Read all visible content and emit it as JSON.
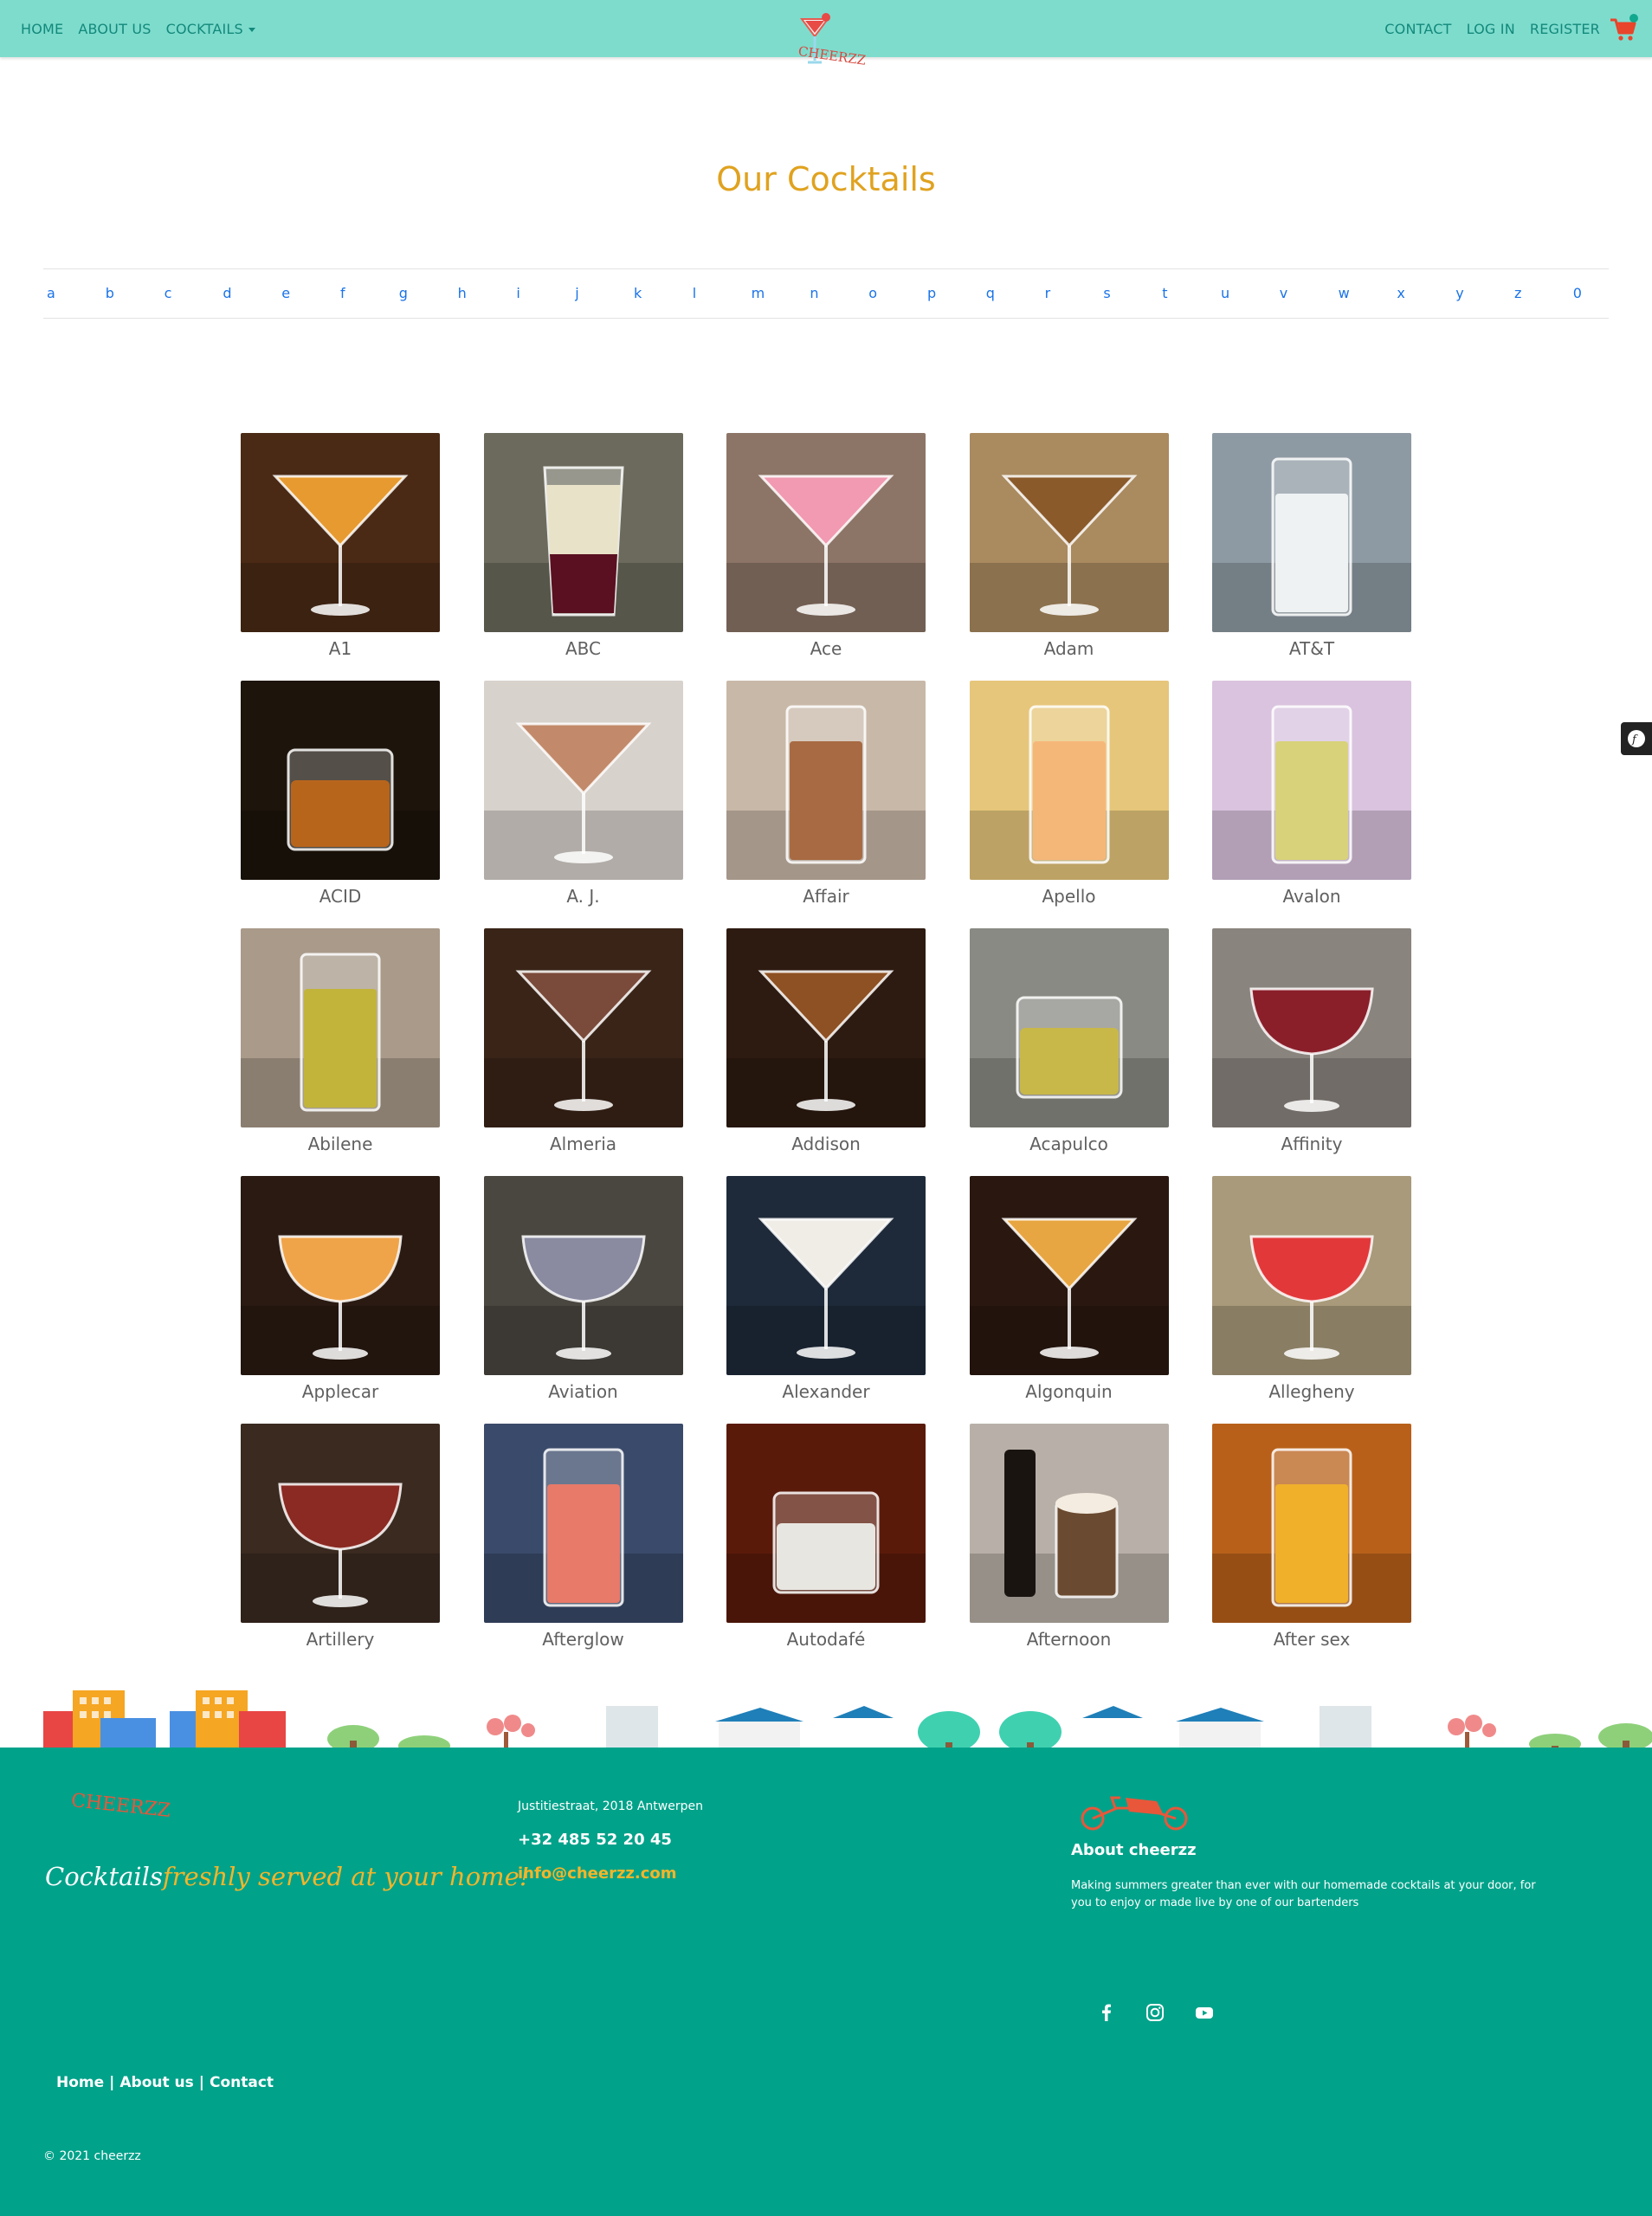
{
  "nav": {
    "home": "HOME",
    "about": "ABOUT US",
    "cocktails": "COCKTAILS",
    "contact": "CONTACT",
    "login": "LOG IN",
    "register": "REGISTER",
    "logo_text": "CHEERZZ"
  },
  "page_title": "Our Cocktails",
  "alphabet": [
    "a",
    "b",
    "c",
    "d",
    "e",
    "f",
    "g",
    "h",
    "i",
    "j",
    "k",
    "l",
    "m",
    "n",
    "o",
    "p",
    "q",
    "r",
    "s",
    "t",
    "u",
    "v",
    "w",
    "x",
    "y",
    "z",
    "0"
  ],
  "cocktails": [
    {
      "name": "A1",
      "bg": "#4a2a15",
      "accent": "#e79a2f",
      "glass": "martini"
    },
    {
      "name": "ABC",
      "bg": "#6b6a5c",
      "accent": "#e8e2c8",
      "glass": "shot"
    },
    {
      "name": "Ace",
      "bg": "#8c7466",
      "accent": "#f19ab1",
      "glass": "martini"
    },
    {
      "name": "Adam",
      "bg": "#aa8a5f",
      "accent": "#8a5a2a",
      "glass": "martini"
    },
    {
      "name": "AT&T",
      "bg": "#8e9aa3",
      "accent": "#eef2f2",
      "glass": "highball"
    },
    {
      "name": "ACID",
      "bg": "#1d140c",
      "accent": "#b8651c",
      "glass": "rocks"
    },
    {
      "name": "A. J.",
      "bg": "#d8d2cc",
      "accent": "#c28a6a",
      "glass": "martini"
    },
    {
      "name": "Affair",
      "bg": "#c8b8a8",
      "accent": "#a86a42",
      "glass": "highball"
    },
    {
      "name": "Apello",
      "bg": "#e6c67a",
      "accent": "#f5b778",
      "glass": "highball"
    },
    {
      "name": "Avalon",
      "bg": "#d9c3df",
      "accent": "#d8d27a",
      "glass": "highball"
    },
    {
      "name": "Abilene",
      "bg": "#a99a8a",
      "accent": "#c2b43a",
      "glass": "highball"
    },
    {
      "name": "Almeria",
      "bg": "#3a2418",
      "accent": "#7a4a3a",
      "glass": "martini"
    },
    {
      "name": "Addison",
      "bg": "#2d1a10",
      "accent": "#8e5123",
      "glass": "martini"
    },
    {
      "name": "Acapulco",
      "bg": "#8a8a84",
      "accent": "#c8b84a",
      "glass": "rocks"
    },
    {
      "name": "Affinity",
      "bg": "#8a847e",
      "accent": "#8a1f2a",
      "glass": "coupe"
    },
    {
      "name": "Applecar",
      "bg": "#2a1a12",
      "accent": "#f0a44a",
      "glass": "coupe"
    },
    {
      "name": "Aviation",
      "bg": "#4a4640",
      "accent": "#8a8aa0",
      "glass": "coupe"
    },
    {
      "name": "Alexander",
      "bg": "#1e2a3a",
      "accent": "#f0ece6",
      "glass": "martini"
    },
    {
      "name": "Algonquin",
      "bg": "#2a1810",
      "accent": "#e8a642",
      "glass": "martini"
    },
    {
      "name": "Allegheny",
      "bg": "#a89a7a",
      "accent": "#e2383a",
      "glass": "coupe"
    },
    {
      "name": "Artillery",
      "bg": "#3a2a20",
      "accent": "#8a2a22",
      "glass": "coupe"
    },
    {
      "name": "Afterglow",
      "bg": "#3a4a6a",
      "accent": "#e87a6a",
      "glass": "highball"
    },
    {
      "name": "Autodafé",
      "bg": "#5a1a0a",
      "accent": "#e8e6e0",
      "glass": "rocks"
    },
    {
      "name": "Afternoon",
      "bg": "#b8b0a8",
      "accent": "#6a4a30",
      "glass": "mug"
    },
    {
      "name": "After sex",
      "bg": "#b8601a",
      "accent": "#f0b02a",
      "glass": "highball"
    }
  ],
  "footer": {
    "logo_text": "CHEERZZ",
    "tagline_part1": "Cocktails",
    "tagline_part2": "freshly served at your home!",
    "address": "Justitiestraat, 2018 Antwerpen",
    "phone": "+32 485 52 20 45",
    "email": "info@cheerzz.com",
    "about_title": "About cheerzz",
    "about_text": "Making summers greater than ever with our homemade cocktails at your door, for you to enjoy or made live by one of our bartenders",
    "links": [
      "Home",
      "About us",
      "Contact"
    ],
    "copyright": "© 2021 cheerzz",
    "social_icons": [
      "facebook-icon",
      "instagram-icon",
      "youtube-icon"
    ]
  },
  "colors": {
    "navbar": "#7edccd",
    "nav_text": "#12897b",
    "title": "#e0a21f",
    "alpha_link": "#1a73e8",
    "footer": "#00a28a",
    "accent_yellow": "#f3b52a",
    "cart": "#e8452a"
  }
}
